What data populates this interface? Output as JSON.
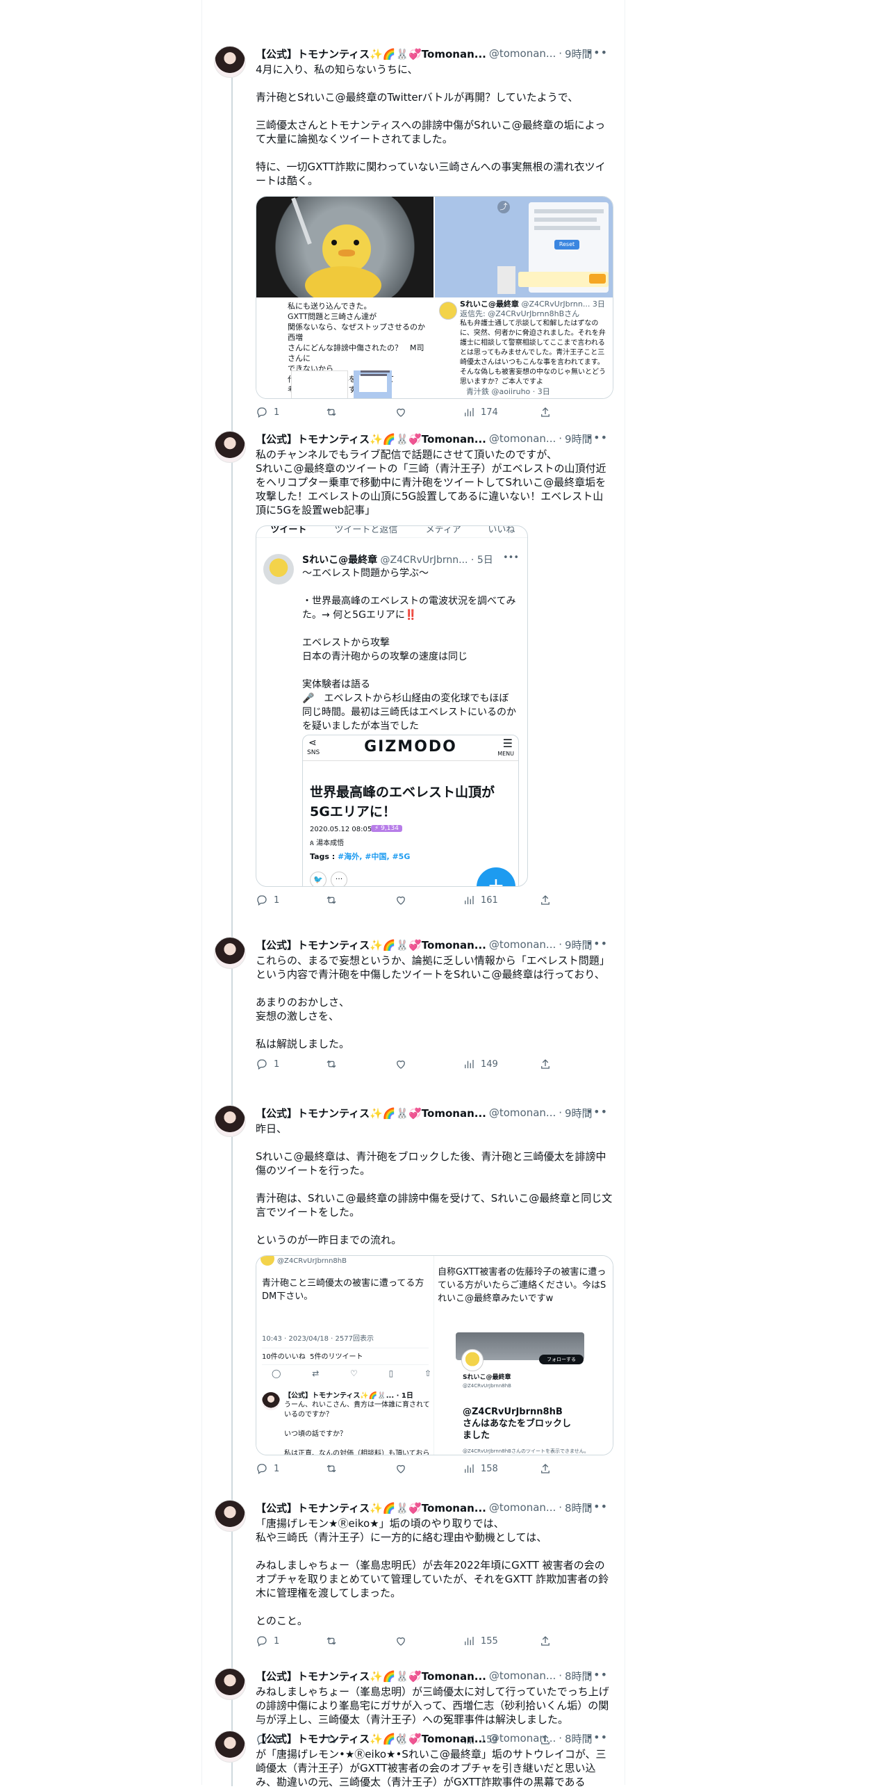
{
  "author": {
    "name": "【公式】トモナンティス✨🌈🐰💞Tomonan...",
    "handle": "@tomonan..."
  },
  "tweets": [
    {
      "time": "9時間",
      "text": "4月に入り、私の知らないうちに、\n\n青汁砲とSれいこ@最終章のTwitterバトルが再開？していたようで、\n\n三崎優太さんとトモナンティスへの誹謗中傷がSれいこ@最終章の垢によって大量に論拠なくツイートされてました。\n\n特に、一切GXTT詐欺に関わっていない三崎さんへの事実無根の濡れ衣ツイートは酷く。",
      "replies": "1",
      "views": "174",
      "media": {
        "left_text": "私にも送り込んできた。\nGXTT問題と三崎さん達が\n関係ないなら、なぜストップさせるのか　西増\nさんにどんな誹謗中傷されたの？　M司さんに\nできないから\n代わりに西増さんをやるなんて\n考えが私は嫌いです。",
        "right_name": "Sれいこ@最終章",
        "right_handle": "@Z4CRvUrJbrnn... 3日",
        "right_reply": "返信先: @Z4CRvUrJbrnn8hBさん",
        "right_text": "私も弁護士通して示談して和解したはずなのに、突然、何者かに脅迫されました。それを弁護士に相談して警察相談してここまで言われるとは思ってもみませんでした。青汁王子こと三崎優太さんはいつもこんな事を言われてます。そんな偽しも被害妄想の中なのじゃ無いとどう思いますか？ご本人ですよ",
        "right_footer": "青汁鉄 @aoiiruho · 3日",
        "dialog_btn": "Reset"
      }
    },
    {
      "time": "9時間",
      "text": "私のチャンネルでもライブ配信で話題にさせて頂いたのですが、\nSれいこ@最終章のツイートの「三崎（青汁王子）がエベレストの山頂付近をヘリコプター乗車で移動中に青汁砲をツイートしてSれいこ@最終章垢を攻撃した！エベレストの山頂に5G設置してあるに違いない！エベレスト山頂に5Gを設置web記事」",
      "replies": "1",
      "views": "161",
      "media": {
        "tabs": [
          "ツイート",
          "ツイートと返信",
          "メディア",
          "いいね"
        ],
        "name": "Sれいこ@最終章",
        "handle": "@Z4CRvUrJbrnn...",
        "time": "5日",
        "text": "〜エベレスト問題から学ぶ〜\n\n・世界最高峰のエベレストの電波状況を調べてみた。→ 何と5Gエリアに‼️\n\nエベレストから攻撃\n日本の青汁砲からの攻撃の速度は同じ\n\n実体験者は語る\n🎤　エベレストから杉山経由の変化球でもほぼ同じ時間。最初は三崎氏はエベレストにいるのかを疑いましたが本当でした",
        "card_sns": "SNS",
        "card_logo": "GIZMODO",
        "card_menu": "MENU",
        "card_title": "世界最高峰のエベレスト山頂が5Gエリアに！",
        "card_date": "2020.05.12 08:05",
        "card_badge": "⚡ 9,134",
        "card_author": "ጰ 湯本成悟",
        "card_tags_label": "Tags :",
        "card_tags": "#海外, #中国, #5G",
        "fab": "+"
      }
    },
    {
      "time": "9時間",
      "text": "これらの、まるで妄想というか、論拠に乏しい情報から「エベレスト問題」という内容で青汁砲を中傷したツイートをSれいこ@最終章は行っており、\n\nあまりのおかしさ、\n妄想の激しさを、\n\n私は解説しました。",
      "replies": "1",
      "views": "149"
    },
    {
      "time": "9時間",
      "text": "昨日、\n\nSれいこ@最終章は、青汁砲をブロックした後、青汁砲と三崎優太を誹謗中傷のツイートを行った。\n\n青汁砲は、Sれいこ@最終章の誹謗中傷を受けて、Sれいこ@最終章と同じ文言でツイートをした。\n\nというのが一昨日までの流れ。",
      "replies": "1",
      "views": "158",
      "media": {
        "left_handle": "@Z4CRvUrJbrnn8hB",
        "left_text": "青汁砲こと三崎優太の被害に遭ってる方\nDM下さい。",
        "left_meta": "10:43 · 2023/04/18 · 2577回表示",
        "left_stats": "10件のいいね  5件のリツイート",
        "left_reply_name": "【公式】トモナンティス✨🌈🐰... · 1日",
        "left_reply_text": "うーん、れいこさん、貴方は一体誰に育されているのですか？\n\nいつ頃の話ですか？\n\n私は正直、なんの対価（相談料）も頂いておら",
        "right_text": "自称GXTT被害者の佐藤玲子の被害に遭っている方がいたらご連絡ください。今はSれいこ@最終章みたいですw",
        "follow_btn": "フォローする",
        "right_name": "Sれいこ@最終章",
        "right_handle": "@Z4CRvUrJbrnn8hB",
        "block_title": "@Z4CRvUrJbrnn8hB さんはあなたをブロックしました",
        "block_sub": "@Z4CRvUrJbrnn8hBさんのツイートを表示できません。"
      }
    },
    {
      "time": "8時間",
      "text": "「唐揚げレモン★Ⓡeiko★」垢の頃のやり取りでは、\n私や三崎氏（青汁王子）に一方的に絡む理由や動機としては、\n\nみねしましゃちょー（峯島忠明氏）が去年2022年頃にGXTT 被害者の会のオプチャを取りまとめていて管理していたが、それをGXTT 詐欺加害者の鈴木に管理権を渡してしまった。\n\nとのこと。",
      "replies": "1",
      "views": "155"
    },
    {
      "time": "8時間",
      "text": "みねしましゃちょー（峯島忠明）が三崎優太に対して行っていたでっち上げの誹謗中傷により峯島宅にガサが入って、西増仁志（砂利拾いくん垢）の関与が浮上し、三崎優太（青汁王子）への冤罪事件は解決しました。",
      "replies": "1",
      "views": "159"
    },
    {
      "time": "8時間",
      "text": "が「唐揚げレモン•★Ⓡeiko★•Sれいこ@最終章」垢のサトウレイコが、三崎優太（青汁王子）がGXTT被害者の会のオプチャを引き継いだと思い込み、勘違いの元、三崎優太（青汁王子）がGXTT詐欺事件の黒幕である"
    }
  ]
}
